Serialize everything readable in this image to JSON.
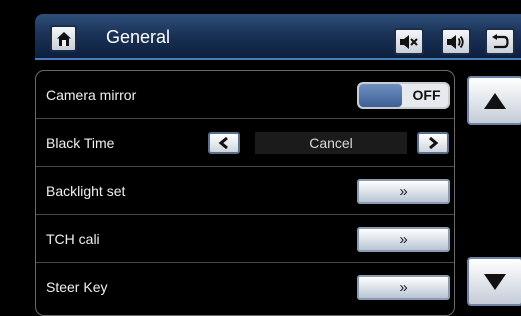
{
  "header": {
    "title": "General"
  },
  "icons": {
    "home": "home-icon",
    "mute": "speaker-mute-icon",
    "volume": "speaker-volume-icon",
    "back": "return-icon",
    "scroll_up": "triangle-up-icon",
    "scroll_down": "triangle-down-icon"
  },
  "settings": [
    {
      "label": "Camera mirror",
      "control": "toggle",
      "value": "OFF"
    },
    {
      "label": "Black Time",
      "control": "stepper",
      "value": "Cancel"
    },
    {
      "label": "Backlight set",
      "control": "link",
      "button": "»"
    },
    {
      "label": "TCH cali",
      "control": "link",
      "button": "»"
    },
    {
      "label": "Steer Key",
      "control": "link",
      "button": "»"
    }
  ],
  "colors": {
    "header_bg": "#1b3358",
    "accent": "#4a7bbd",
    "background": "#000000"
  }
}
